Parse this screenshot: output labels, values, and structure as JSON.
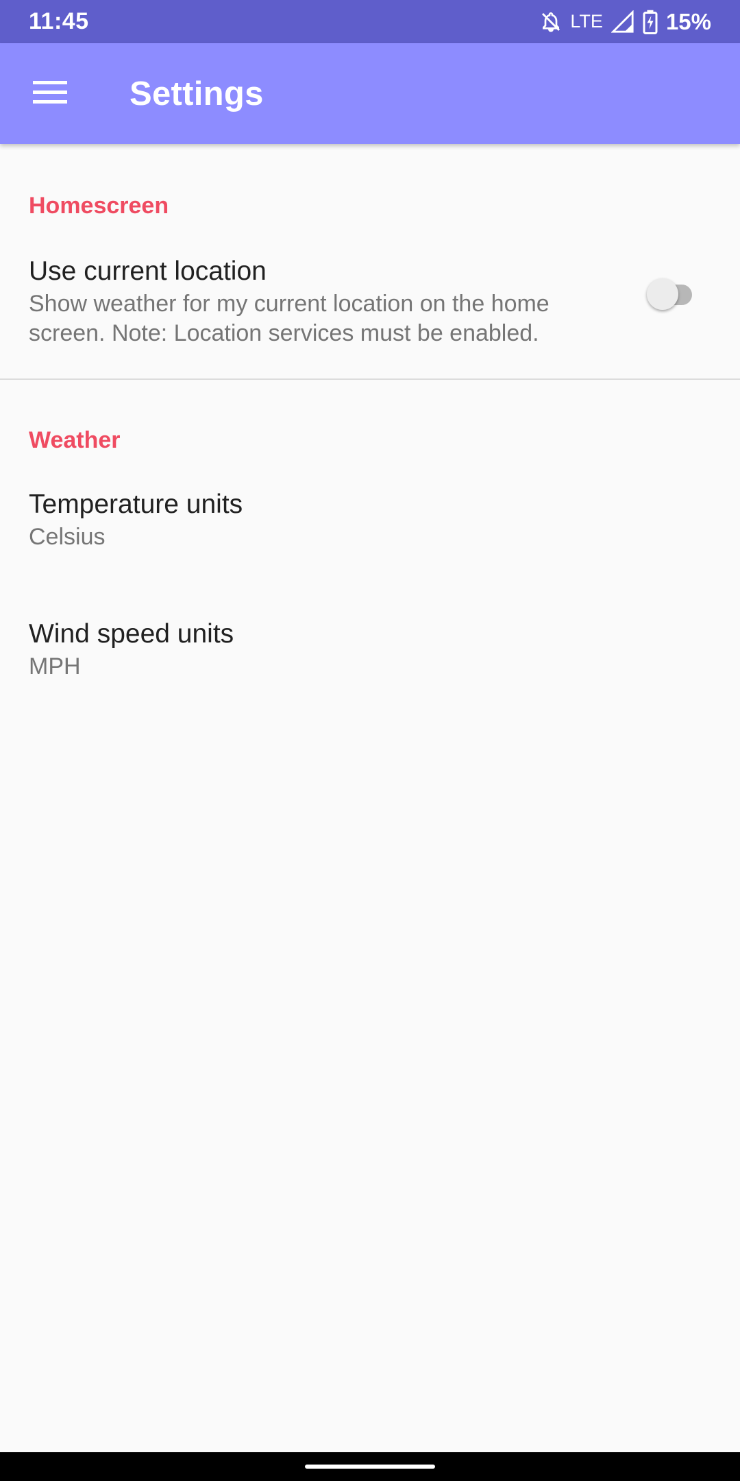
{
  "status_bar": {
    "time": "11:45",
    "network": "LTE",
    "battery": "15%",
    "icons": [
      "notifications-off-icon",
      "signal-icon",
      "battery-charging-icon"
    ]
  },
  "app_bar": {
    "title": "Settings",
    "menu_icon": "hamburger-menu-icon",
    "color": "#8d8cff"
  },
  "sections": {
    "homescreen": {
      "header": "Homescreen",
      "use_location": {
        "title": "Use current location",
        "summary": "Show weather for my current location on the home screen. Note: Location services must be enabled.",
        "enabled": false
      }
    },
    "weather": {
      "header": "Weather",
      "temperature": {
        "title": "Temperature units",
        "value": "Celsius"
      },
      "wind": {
        "title": "Wind speed units",
        "value": "MPH"
      }
    }
  },
  "colors": {
    "status_bar": "#5f5ecb",
    "accent": "#ef4b61",
    "background": "#fafafa"
  }
}
